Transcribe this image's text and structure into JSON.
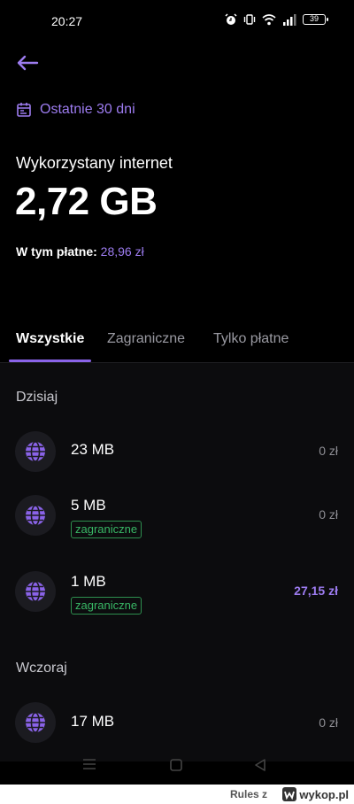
{
  "status_bar": {
    "time": "20:27",
    "battery": "39"
  },
  "period": {
    "label": "Ostatnie 30 dni"
  },
  "usage": {
    "title": "Wykorzystany internet",
    "value": "2,72 GB",
    "paid_label": "W tym płatne:",
    "paid_value": "28,96 zł"
  },
  "tabs": [
    {
      "label": "Wszystkie",
      "active": true
    },
    {
      "label": "Zagraniczne",
      "active": false
    },
    {
      "label": "Tylko płatne",
      "active": false
    }
  ],
  "sections": [
    {
      "header": "Dzisiaj",
      "rows": [
        {
          "amount": "23 MB",
          "price": "0 zł",
          "tag": ""
        },
        {
          "amount": "5 MB",
          "price": "0 zł",
          "tag": "zagraniczne"
        },
        {
          "amount": "1 MB",
          "price": "27,15 zł",
          "tag": "zagraniczne"
        }
      ]
    },
    {
      "header": "Wczoraj",
      "rows": [
        {
          "amount": "17 MB",
          "price": "0 zł",
          "tag": ""
        }
      ]
    }
  ],
  "watermark": {
    "text": "Rules z",
    "logo": "wykop.pl"
  },
  "colors": {
    "accent": "#9d7cf0",
    "tag_green": "#39b866",
    "background": "#000000"
  },
  "icons": {
    "back": "arrow-left-icon",
    "calendar": "calendar-icon",
    "globe": "globe-icon"
  }
}
